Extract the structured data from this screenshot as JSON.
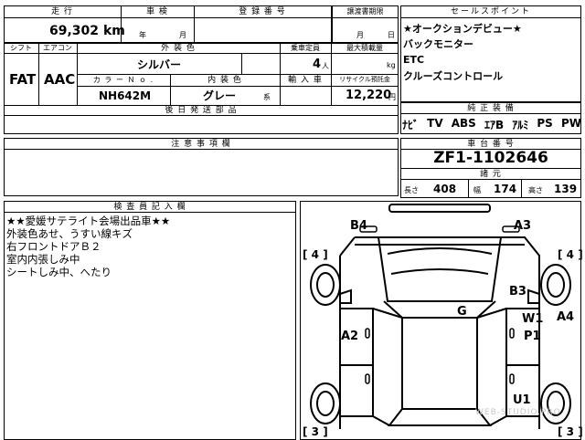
{
  "header": {
    "mileage_label": "走 行",
    "mileage_value": "69,302",
    "mileage_unit": "km",
    "inspection_label": "車 検",
    "inspection_year": "年",
    "inspection_month": "月",
    "registration_label": "登 録 番 号",
    "transfer_deadline_label": "譲渡書期限",
    "transfer_month": "月",
    "transfer_day": "日"
  },
  "specs": {
    "shift_label": "シフト",
    "shift_value": "FAT",
    "aircon_label": "エアコン",
    "aircon_value": "AAC",
    "exterior_label": "外 装 色",
    "exterior_value": "シルバー",
    "capacity_label": "乗車定員",
    "capacity_value": "4",
    "capacity_unit": "人",
    "max_load_label": "最大積載量",
    "max_load_unit": "kg",
    "color_no_label": "カ ラ ー Ｎ ｏ .",
    "color_no_value": "NH642M",
    "interior_label": "内 装 色",
    "interior_value": "グレー",
    "interior_suffix": "系",
    "import_label": "輸 入 車",
    "recycle_label": "リサイクル預託金",
    "recycle_value": "12,220",
    "recycle_unit": "円",
    "later_docs_label": "後 日 発 送 部 品"
  },
  "sales_points": {
    "title": "セールスポイント",
    "lines": [
      "★オークションデビュー★",
      "バックモニター",
      "ETC",
      "クルーズコントロール"
    ]
  },
  "equipment": {
    "title": "純 正 装 備",
    "items": [
      "ﾅﾋﾞ",
      "TV",
      "ABS",
      "ｴｱB",
      "ｱﾙﾐ",
      "PS",
      "PW"
    ]
  },
  "notes": {
    "title": "注 意 事 項 欄"
  },
  "frame": {
    "title": "車 台 番 号",
    "value": "ZF1-1102646",
    "dims_title": "諸 元",
    "length_label": "長さ",
    "length_value": "408",
    "width_label": "幅",
    "width_value": "174",
    "height_label": "高さ",
    "height_value": "139"
  },
  "inspector": {
    "title": "検 査 員 記 入 欄",
    "lines": [
      "★★愛媛サテライト会場出品車★★",
      "外装色あせ、うすい線キズ",
      "右フロントドアＢ２",
      "室内内張しみ中",
      "シートしみ中、へたり"
    ]
  },
  "diagram": {
    "marks": [
      "B4",
      "A3",
      "[ 4 ]",
      "[ 4 ]",
      "B3",
      "G",
      "W1",
      "A4",
      "A2",
      "P1",
      "U1",
      "[ 3 ]",
      "[ 3 ]"
    ]
  },
  "watermark": "WEB-STUDIO.PRO"
}
